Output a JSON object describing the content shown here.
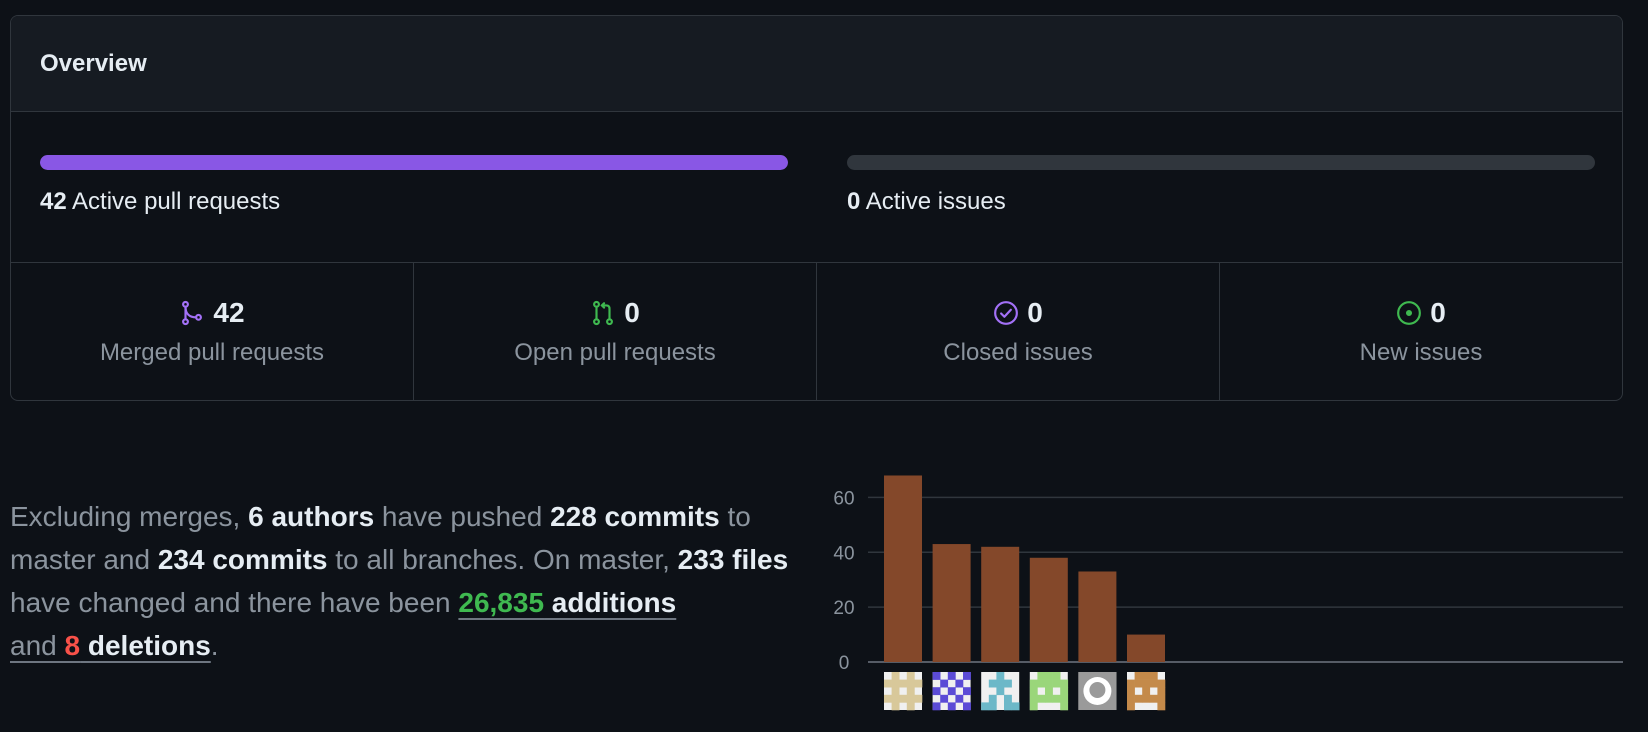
{
  "overview": {
    "title": "Overview",
    "pull_requests": {
      "count": "42",
      "label": "Active pull requests",
      "fill_fraction": 1.0,
      "color": "#8957e5"
    },
    "issues": {
      "count": "0",
      "label": "Active issues",
      "fill_fraction": 0.0
    },
    "stats": [
      {
        "value": "42",
        "label": "Merged pull requests",
        "icon": "git-merge-icon",
        "color": "#a371f7"
      },
      {
        "value": "0",
        "label": "Open pull requests",
        "icon": "git-pull-request-icon",
        "color": "#3fb950"
      },
      {
        "value": "0",
        "label": "Closed issues",
        "icon": "issue-closed-icon",
        "color": "#a371f7"
      },
      {
        "value": "0",
        "label": "New issues",
        "icon": "issue-opened-icon",
        "color": "#3fb950"
      }
    ]
  },
  "summary": {
    "t1": "Excluding merges, ",
    "authors": "6 authors",
    "t2": " have pushed ",
    "commits_master": "228 commits",
    "t3": " to master and ",
    "commits_all": "234 commits",
    "t4": " to all branches. On master, ",
    "files": "233 files",
    "t5": " have changed and there have been ",
    "additions_num": "26,835",
    "additions_word": " additions",
    "t6": "and ",
    "deletions_num": "8",
    "deletions_word": " deletions",
    "t7": "."
  },
  "chart_data": {
    "type": "bar",
    "categories": [
      "author-1",
      "author-2",
      "author-3",
      "author-4",
      "author-5",
      "author-6"
    ],
    "values": [
      68,
      43,
      42,
      38,
      33,
      10
    ],
    "ylim": [
      0,
      70
    ],
    "yticks": [
      "0",
      "20",
      "40",
      "60"
    ],
    "grid": true,
    "bar_color": "#84482a",
    "avatar_colors": [
      "#d8c89a",
      "#5b4bd6",
      "#6cb8c8",
      "#9ad67a",
      "#9a9a9a",
      "#c48a4a"
    ]
  }
}
